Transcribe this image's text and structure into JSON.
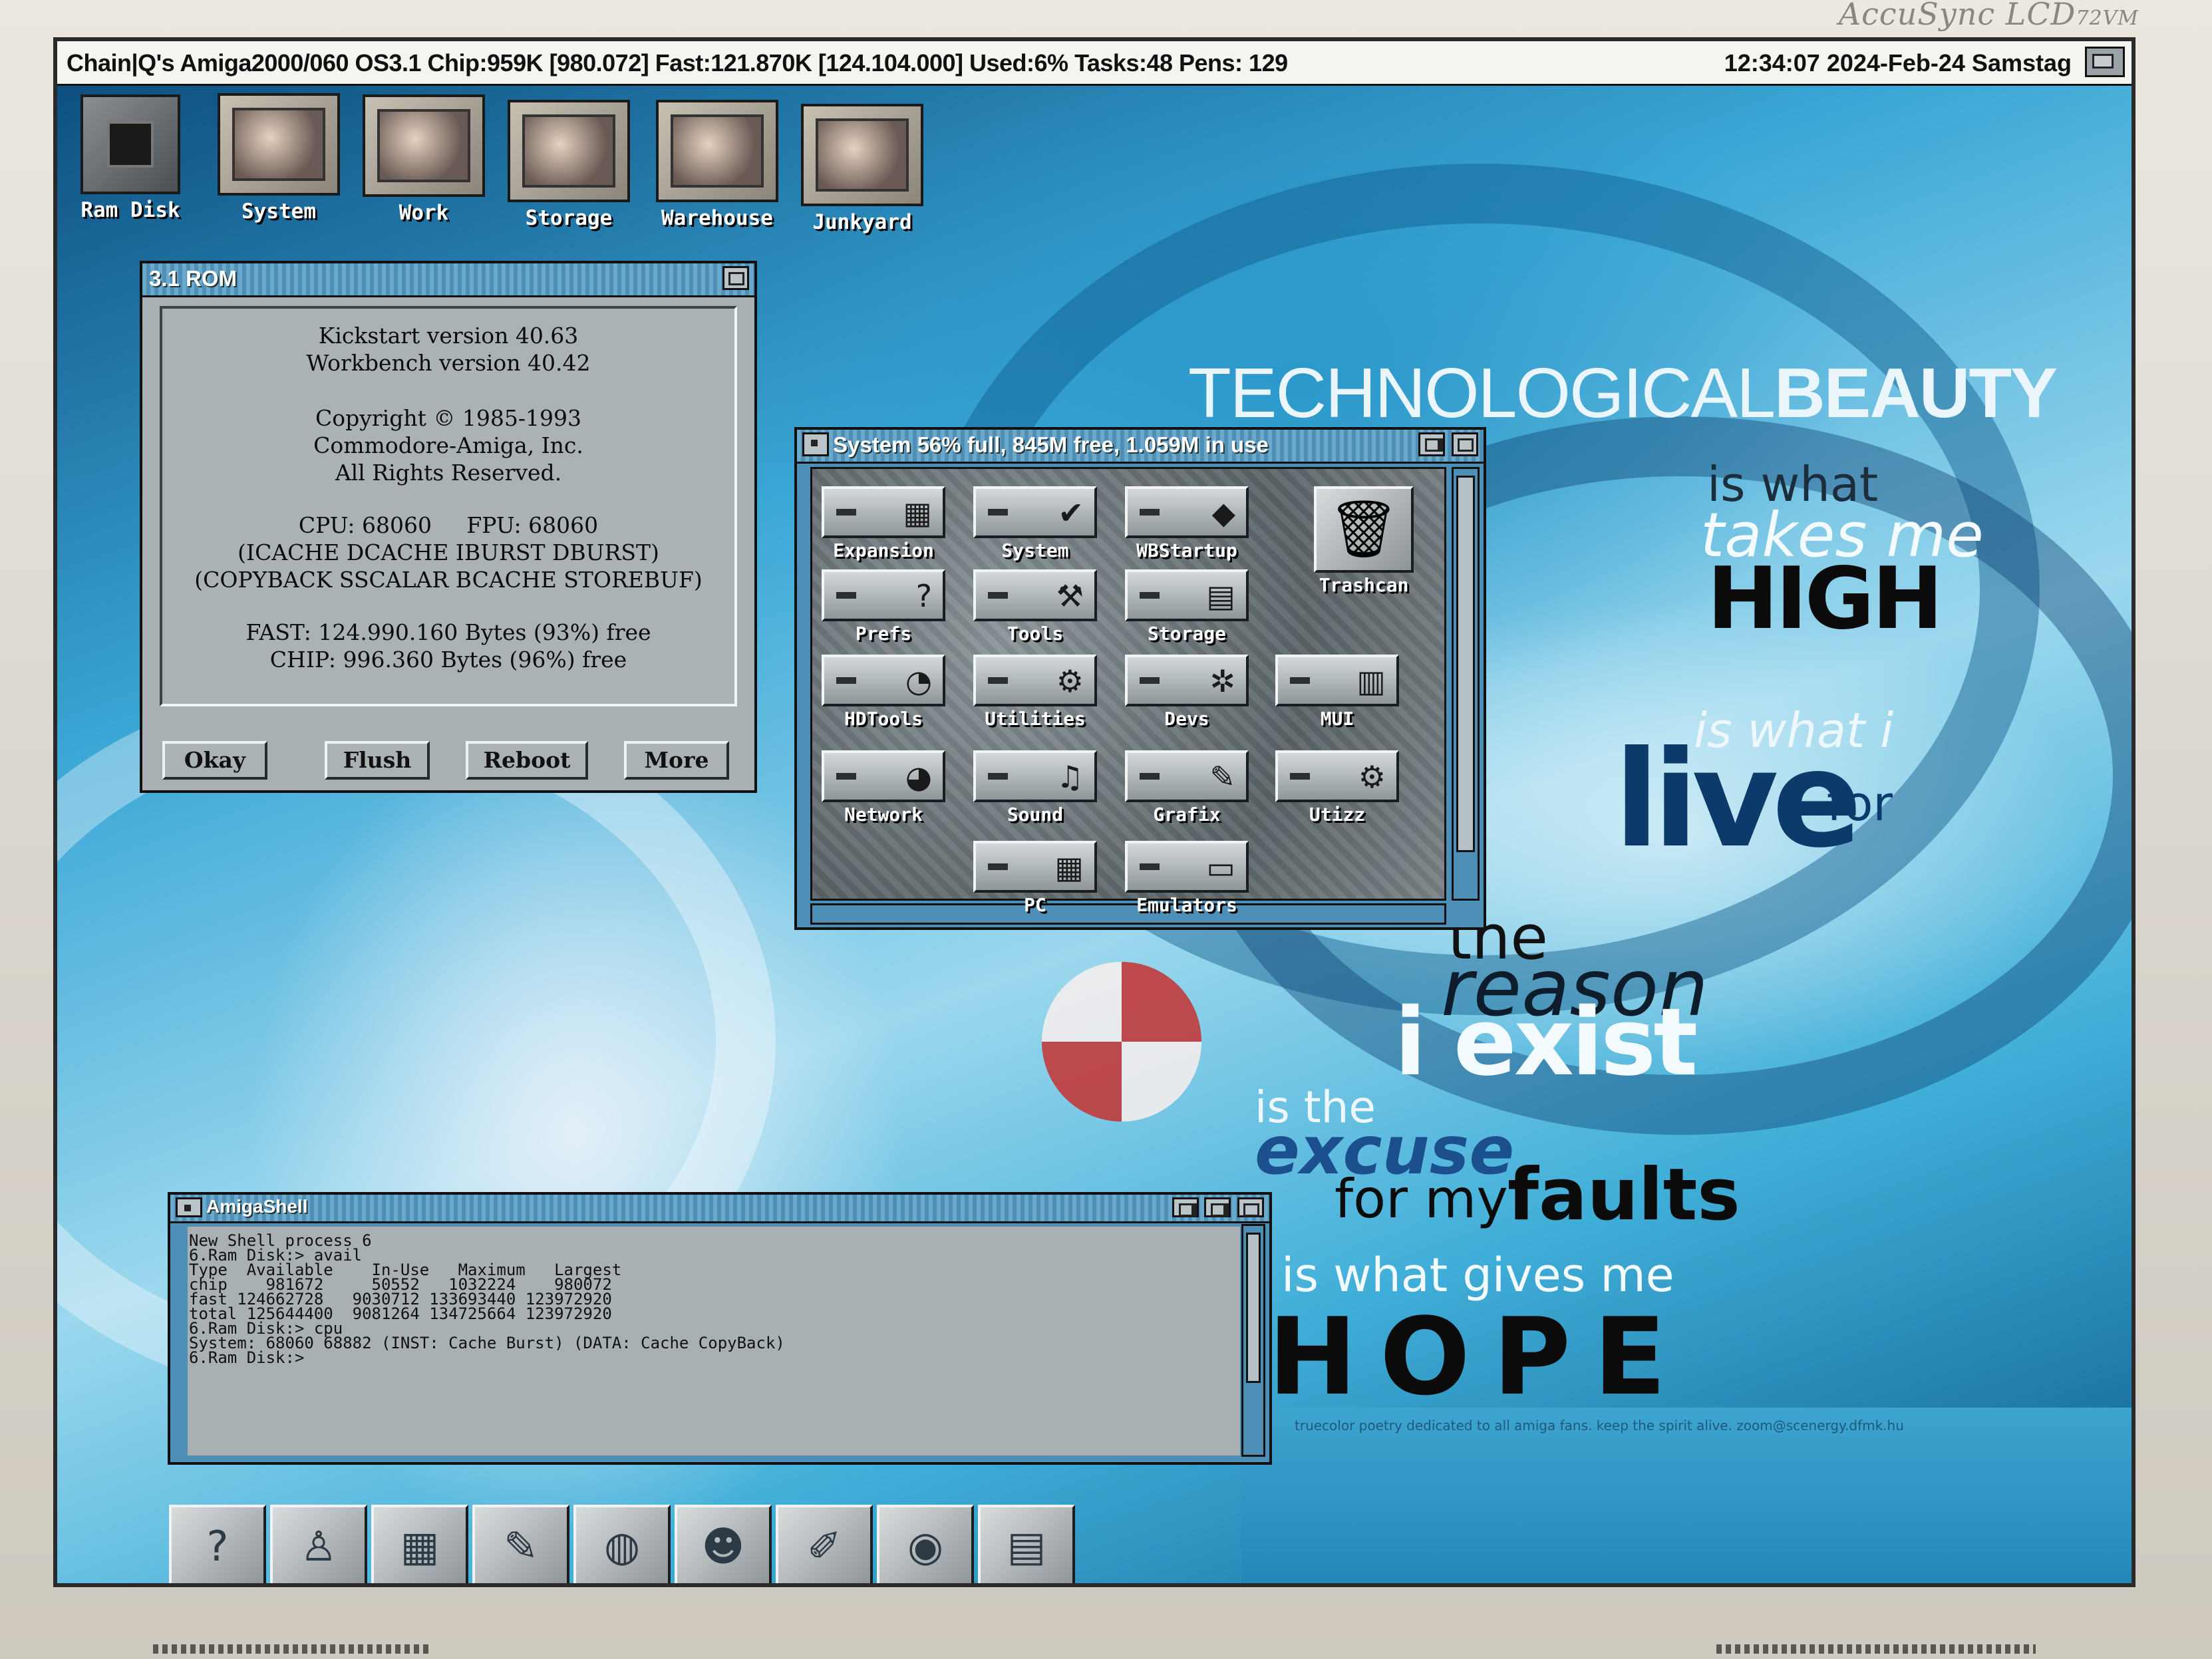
{
  "monitor": {
    "brand": "AccuSync LCD",
    "model": "72VM"
  },
  "screen_bar": {
    "left": "Chain|Q's Amiga2000/060 OS3.1  Chip:959K [980.072] Fast:121.870K [124.104.000] Used:6%  Tasks:48  Pens: 129",
    "right": "12:34:07 2024-Feb-24 Samstag"
  },
  "drives": [
    {
      "label": "Ram Disk",
      "icon": "ram-chip-icon"
    },
    {
      "label": "System",
      "icon": "hard-disk-icon"
    },
    {
      "label": "Work",
      "icon": "hard-disk-icon"
    },
    {
      "label": "Storage",
      "icon": "hard-disk-icon"
    },
    {
      "label": "Warehouse",
      "icon": "hard-disk-icon"
    },
    {
      "label": "Junkyard",
      "icon": "hard-disk-icon"
    }
  ],
  "about": {
    "title": "3.1 ROM",
    "kickstart": "Kickstart version 40.63",
    "workbench": "Workbench version 40.42",
    "copyright": "Copyright © 1985-1993",
    "company": "Commodore-Amiga, Inc.",
    "rights": "All Rights Reserved.",
    "cpu_line": "CPU: 68060     FPU: 68060",
    "icache": "(ICACHE DCACHE IBURST DBURST)",
    "copyback": "(COPYBACK SSCALAR BCACHE STOREBUF)",
    "fast": "FAST: 124.990.160 Bytes  (93%) free",
    "chip": "CHIP: 996.360 Bytes  (96%) free",
    "buttons": {
      "okay": "Okay",
      "flush": "Flush",
      "reboot": "Reboot",
      "more": "More"
    }
  },
  "system_window": {
    "title": "System  56% full, 845M free, 1.059M in use",
    "items": [
      {
        "label": "Expansion",
        "glyph": "▦"
      },
      {
        "label": "System",
        "glyph": "✔"
      },
      {
        "label": "WBStartup",
        "glyph": "◆"
      },
      {
        "label": "Prefs",
        "glyph": "?"
      },
      {
        "label": "Tools",
        "glyph": "⚒"
      },
      {
        "label": "Storage",
        "glyph": "▤"
      },
      {
        "label": "HDTools",
        "glyph": "◔"
      },
      {
        "label": "Utilities",
        "glyph": "⚙"
      },
      {
        "label": "Devs",
        "glyph": "✲"
      },
      {
        "label": "MUI",
        "glyph": "▥"
      },
      {
        "label": "Network",
        "glyph": "◕"
      },
      {
        "label": "Sound",
        "glyph": "♫"
      },
      {
        "label": "Grafix",
        "glyph": "✎"
      },
      {
        "label": "Utizz",
        "glyph": "⚙"
      },
      {
        "label": "PC",
        "glyph": "▦"
      },
      {
        "label": "Emulators",
        "glyph": "▭"
      }
    ],
    "trashcan": {
      "label": "Trashcan",
      "glyph": "🗑"
    }
  },
  "shell": {
    "title": "AmigaShell",
    "lines": [
      "New Shell process 6",
      "6.Ram Disk:> avail",
      "Type  Available    In-Use   Maximum   Largest",
      "chip    981672     50552   1032224    980072",
      "fast 124662728   9030712 133693440 123972920",
      "total 125644400  9081264 134725664 123972920",
      "6.Ram Disk:> cpu",
      "System: 68060 68882 (INST: Cache Burst) (DATA: Cache CopyBack)",
      "6.Ram Disk:> "
    ]
  },
  "wallpaper": {
    "headline_a": "TECHNOLOGICAL",
    "headline_b": "BEAUTY",
    "l1": "is what",
    "l2": "takes me",
    "l3": "HIGH",
    "l4": "is what i",
    "l5": "live",
    "l6": "for",
    "l7": "the",
    "l8": "reason",
    "l9": "i exist",
    "l10": "is the",
    "l11": "excuse",
    "l12": "for my",
    "l13": "faults",
    "l14": "is what gives me",
    "l15": "HOPE",
    "tagline": "truecolor poetry dedicated to all amiga fans. keep the spirit alive.  zoom@scenergy.dfmk.hu"
  },
  "dock": [
    {
      "icon": "help-icon",
      "glyph": "?"
    },
    {
      "icon": "user-icon",
      "glyph": "♙"
    },
    {
      "icon": "table-icon",
      "glyph": "▦"
    },
    {
      "icon": "editor-icon",
      "glyph": "✎"
    },
    {
      "icon": "globe-icon",
      "glyph": "◍"
    },
    {
      "icon": "creature-icon",
      "glyph": "☻"
    },
    {
      "icon": "paint-icon",
      "glyph": "✐"
    },
    {
      "icon": "eye-icon",
      "glyph": "◉"
    },
    {
      "icon": "film-icon",
      "glyph": "▤"
    }
  ]
}
